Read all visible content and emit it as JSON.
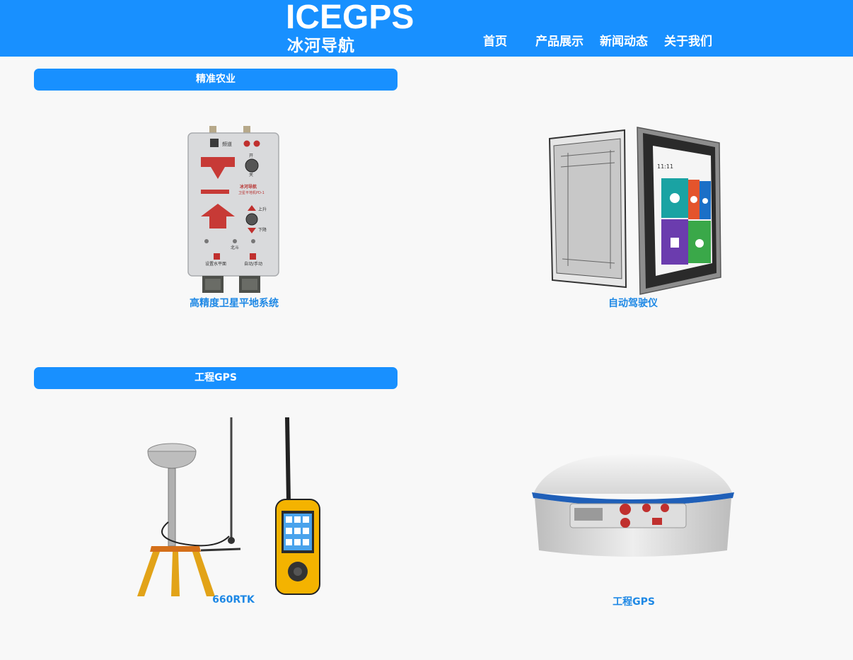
{
  "header": {
    "logo_en": "ICEGPS",
    "logo_cn": "冰河导航",
    "nav": [
      {
        "label": "首页"
      },
      {
        "label": "产品展示"
      },
      {
        "label": "新闻动态"
      },
      {
        "label": "关于我们"
      }
    ],
    "bg_color": "#1890ff"
  },
  "sections": [
    {
      "title": "精准农业",
      "products": [
        {
          "caption": "高精度卫星平地系统",
          "icon": "leveling-controller-image",
          "device_text": {
            "channel": "频道",
            "on": "开",
            "off": "关",
            "brand": "冰河导航",
            "model": "卫星平地机PD-1",
            "up": "上升",
            "down": "下降",
            "beidou": "北斗",
            "set_level": "设置水平面",
            "auto_manual": "自动/手动"
          }
        },
        {
          "caption": "自动驾驶仪",
          "icon": "autopilot-tablet-image",
          "device_text": {
            "time": "11:11"
          }
        }
      ]
    },
    {
      "title": "工程GPS",
      "products": [
        {
          "caption": "660RTK",
          "icon": "rtk-kit-image"
        },
        {
          "caption": "工程GPS",
          "icon": "gnss-receiver-image"
        }
      ]
    }
  ]
}
